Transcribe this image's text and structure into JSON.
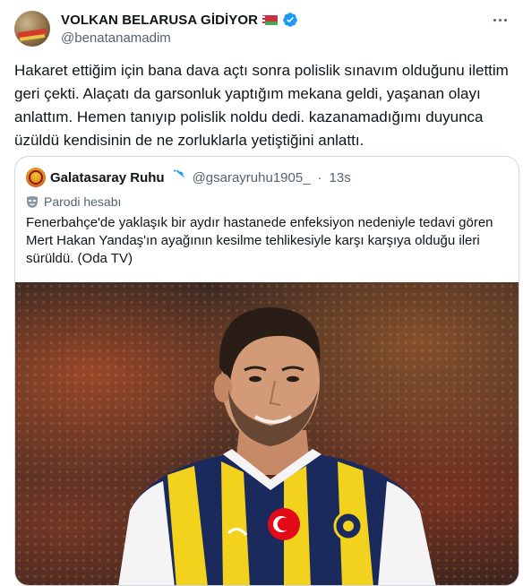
{
  "author": {
    "display_name": "VOLKAN BELARUSA GİDİYOR",
    "handle": "@benatanamadim",
    "avatar_icon": "user-avatar",
    "flag_icon": "belarus-flag-icon",
    "verified_icon": "verified-badge-icon"
  },
  "tweet": {
    "text": "Hakaret ettiğim için bana dava açtı sonra polislik sınavım olduğunu ilettim geri çekti. Alaçatı da garsonluk yaptığım mekana geldi, yaşanan olayı anlattım. Hemen tanıyıp polislik noldu dedi. kazanamadığımı duyunca üzüldü kendisinin de ne zorluklarla yetiştiğini anlattı."
  },
  "quoted": {
    "display_name": "Galatasaray Ruhu",
    "handle": "@gsarayruhu1905_",
    "separator": "·",
    "time": "13s",
    "parody_label": "Parodi hesabı",
    "text": "Fenerbahçe'de yaklaşık bir aydır hastanede enfeksiyon nedeniyle tedavi gören Mert Hakan Yandaş'ın ayağının kesilme tehlikesiyle karşı karşıya olduğu ileri sürüldü. (Oda TV)"
  },
  "colors": {
    "text": "#0f1419",
    "muted": "#536471",
    "verified": "#1d9bf0",
    "border": "#cfd9de"
  }
}
